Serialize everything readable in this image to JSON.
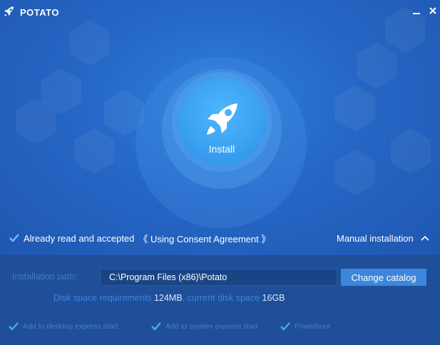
{
  "app": {
    "title": "POTATO"
  },
  "window": {
    "minimize": "—",
    "close": "×"
  },
  "install": {
    "label": "Install"
  },
  "agreement": {
    "text": "Already read and accepted",
    "link": "《 Using Consent Agreement 》",
    "checked": true
  },
  "manual": {
    "label": "Manual installation"
  },
  "path": {
    "label": "Installation  path:",
    "value": "C:\\Program Files (x86)\\Potato",
    "change_button": "Change catalog"
  },
  "disk": {
    "required_label": "Disk space requirements",
    "required_value": "124MB",
    "sep": ",",
    "current_label": "current disk space",
    "current_value": "16GB"
  },
  "options": [
    {
      "label": "Add to desktop express start",
      "checked": true
    },
    {
      "label": "Add to system express start",
      "checked": true
    },
    {
      "label": "Powerboot",
      "checked": true
    }
  ],
  "colors": {
    "accent": "#3d86dc",
    "background": "#2567c6",
    "footer": "#1e4f98"
  }
}
